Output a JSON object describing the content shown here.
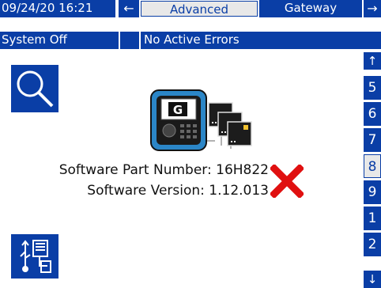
{
  "header": {
    "datetime": "09/24/20 16:21",
    "active_tab": "Advanced",
    "next_tab": "Gateway",
    "status": "System Off",
    "error_text": "No Active Errors"
  },
  "icons": {
    "left_arrow": "←",
    "right_arrow": "→",
    "up_arrow": "↑",
    "down_arrow": "↓",
    "search": "search-icon",
    "usb": "usb-transfer-icon",
    "error": "red-x-icon"
  },
  "main": {
    "part_number_label": "Software Part Number:",
    "part_number_value": "16H822",
    "version_label": "Software Version:",
    "version_value": "1.12.013"
  },
  "side_pages": [
    "5",
    "6",
    "7",
    "8",
    "9",
    "1",
    "2"
  ],
  "selected_page": "8",
  "colors": {
    "accent": "#0a3ea6",
    "error": "#e01010",
    "tab_bg": "#e8e8e8"
  }
}
